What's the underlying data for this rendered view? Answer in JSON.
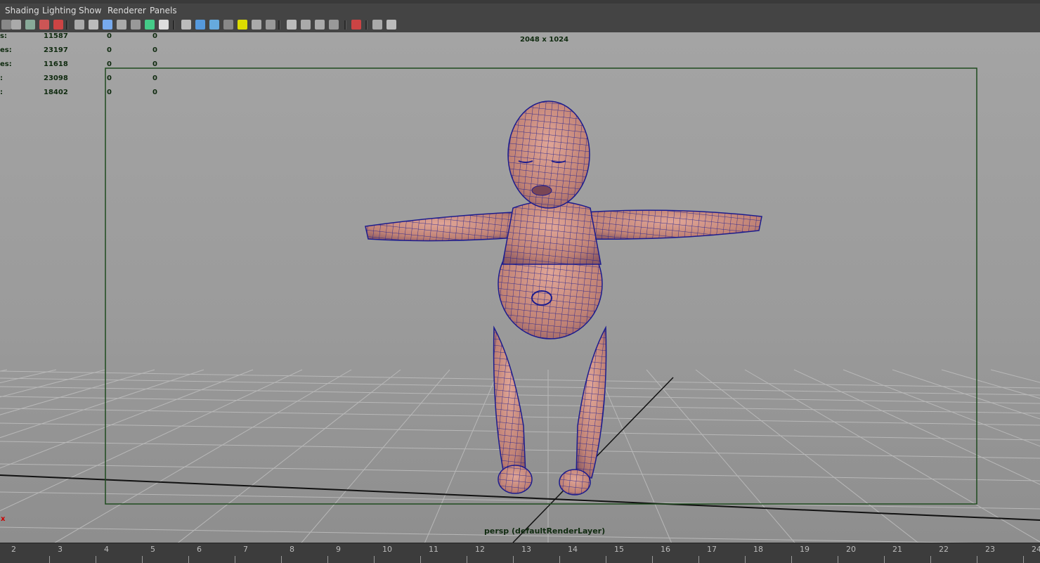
{
  "menu": [
    "Shading",
    "Lighting",
    "Show",
    "Renderer",
    "Panels"
  ],
  "toolbar_icons": [
    "camera-attrs-icon",
    "bookmark-icon",
    "image-plane-icon",
    "2d-pan-zoom-icon",
    "grease-pencil-icon",
    "grid-icon",
    "film-gate-icon",
    "resolution-gate-icon",
    "gate-mask-icon",
    "field-chart-icon",
    "safe-action-icon",
    "safe-title-icon",
    "wireframe-icon",
    "smooth-shade-icon",
    "wireframe-on-shaded-icon",
    "textured-icon",
    "use-all-lights-icon",
    "shadows-icon",
    "screen-space-ao-icon",
    "motion-blur-icon",
    "multisample-aa-icon",
    "depth-of-field-icon",
    "isolate-select-icon",
    "xray-icon",
    "xray-joints-icon",
    "xray-components-icon"
  ],
  "hud": {
    "rows": [
      {
        "label": "s:",
        "v1": "11587",
        "v2": "0",
        "v3": "0"
      },
      {
        "label": "es:",
        "v1": "23197",
        "v2": "0",
        "v3": "0"
      },
      {
        "label": "es:",
        "v1": "11618",
        "v2": "0",
        "v3": "0"
      },
      {
        "label": ":",
        "v1": "23098",
        "v2": "0",
        "v3": "0"
      },
      {
        "label": ":",
        "v1": "18402",
        "v2": "0",
        "v3": "0"
      }
    ],
    "resolution": "2048 x 1024",
    "camera": "persp (defaultRenderLayer)",
    "axis_label": "x"
  },
  "timeline": {
    "ticks": [
      "2",
      "3",
      "4",
      "5",
      "6",
      "7",
      "8",
      "9",
      "10",
      "11",
      "12",
      "13",
      "14",
      "15",
      "16",
      "17",
      "18",
      "19",
      "20",
      "21",
      "22",
      "23",
      "24"
    ]
  },
  "colors": {
    "wire": "#1c1c8e",
    "skin": "#c9877c",
    "gate": "#1e4a1e",
    "background": "#9f9f9f"
  }
}
